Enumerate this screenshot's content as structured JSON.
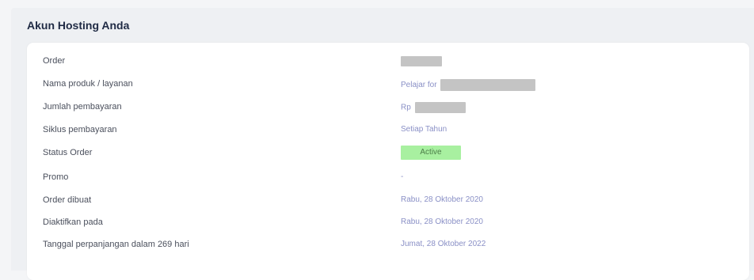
{
  "panel": {
    "title": "Akun Hosting Anda"
  },
  "rows": [
    {
      "label": "Order",
      "value": ""
    },
    {
      "label": "Nama produk / layanan",
      "value": "Pelajar for"
    },
    {
      "label": "Jumlah pembayaran",
      "value": "Rp"
    },
    {
      "label": "Siklus pembayaran",
      "value": "Setiap Tahun"
    },
    {
      "label": "Status Order",
      "value": "Active"
    },
    {
      "label": "Promo",
      "value": "-"
    },
    {
      "label": "Order dibuat",
      "value": "Rabu, 28 Oktober 2020"
    },
    {
      "label": "Diaktifkan pada",
      "value": "Rabu, 28 Oktober 2020"
    },
    {
      "label": "Tanggal perpanjangan dalam 269 hari",
      "value": "Jumat, 28 Oktober 2022"
    }
  ],
  "colors": {
    "value_text": "#8a90c6",
    "status_active_bg": "#a8f0a0",
    "status_active_text": "#4c7e48",
    "title_text": "#1f2a44"
  }
}
